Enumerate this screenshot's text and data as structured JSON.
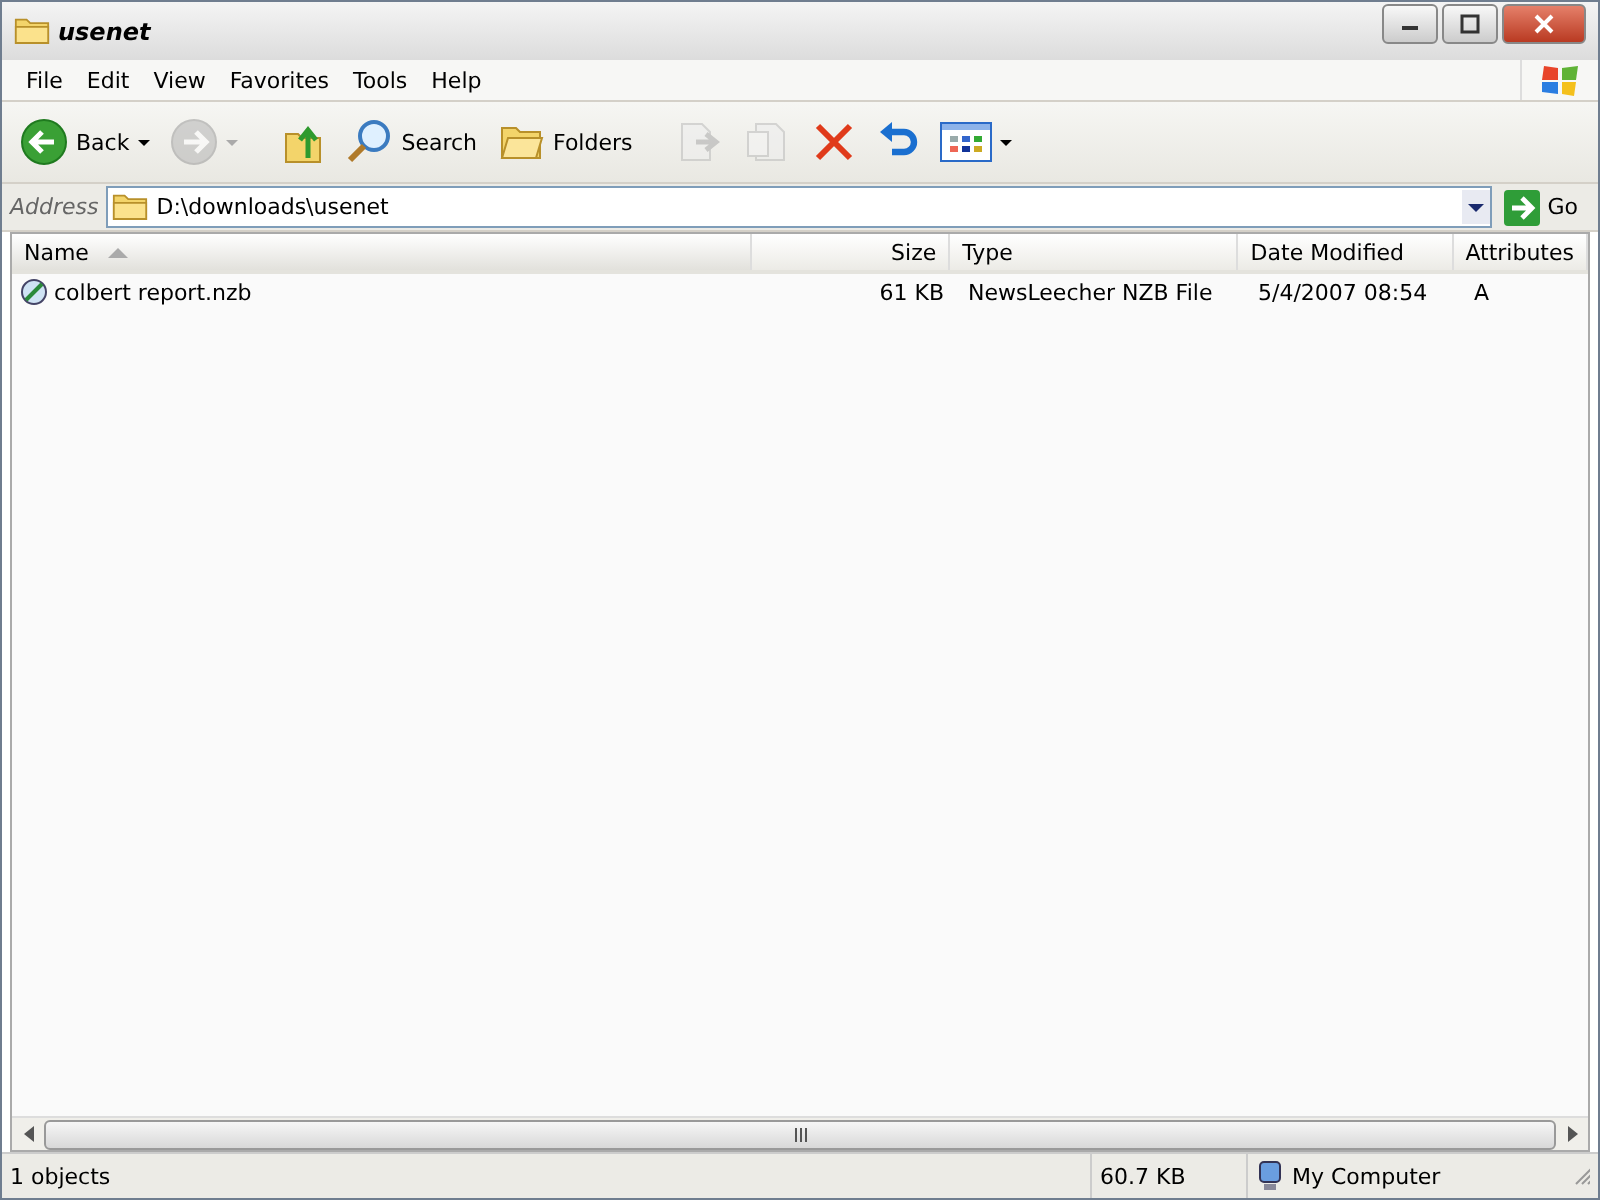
{
  "window": {
    "title": "usenet"
  },
  "menu": [
    "File",
    "Edit",
    "View",
    "Favorites",
    "Tools",
    "Help"
  ],
  "toolbar": [
    {
      "kind": "back",
      "label": "Back",
      "disabled": false
    },
    {
      "kind": "forward",
      "disabled": true
    },
    {
      "kind": "up",
      "disabled": false
    },
    {
      "kind": "search",
      "label": "Search",
      "disabled": false
    },
    {
      "kind": "folders",
      "label": "Folders",
      "disabled": false
    },
    {
      "kind": "move",
      "disabled": true
    },
    {
      "kind": "copy",
      "disabled": true
    },
    {
      "kind": "delete",
      "disabled": false
    },
    {
      "kind": "undo",
      "disabled": false
    },
    {
      "kind": "views",
      "disabled": false
    }
  ],
  "address": {
    "label": "Address",
    "value": "D:\\downloads\\usenet",
    "go": "Go"
  },
  "table": {
    "columns": [
      {
        "label": "Name",
        "sorted": true
      },
      {
        "label": "Size",
        "sorted": false
      },
      {
        "label": "Type",
        "sorted": false
      },
      {
        "label": "Date Modified",
        "sorted": false
      },
      {
        "label": "Attributes",
        "sorted": false
      }
    ],
    "rows": [
      {
        "cells": [
          "colbert report.nzb",
          "61 KB",
          "NewsLeecher NZB File",
          "5/4/2007 08:54",
          "A"
        ],
        "selected": false
      }
    ]
  },
  "status_bar": {
    "objects": "1 objects",
    "size": "60.7 KB",
    "zone": "My Computer"
  }
}
